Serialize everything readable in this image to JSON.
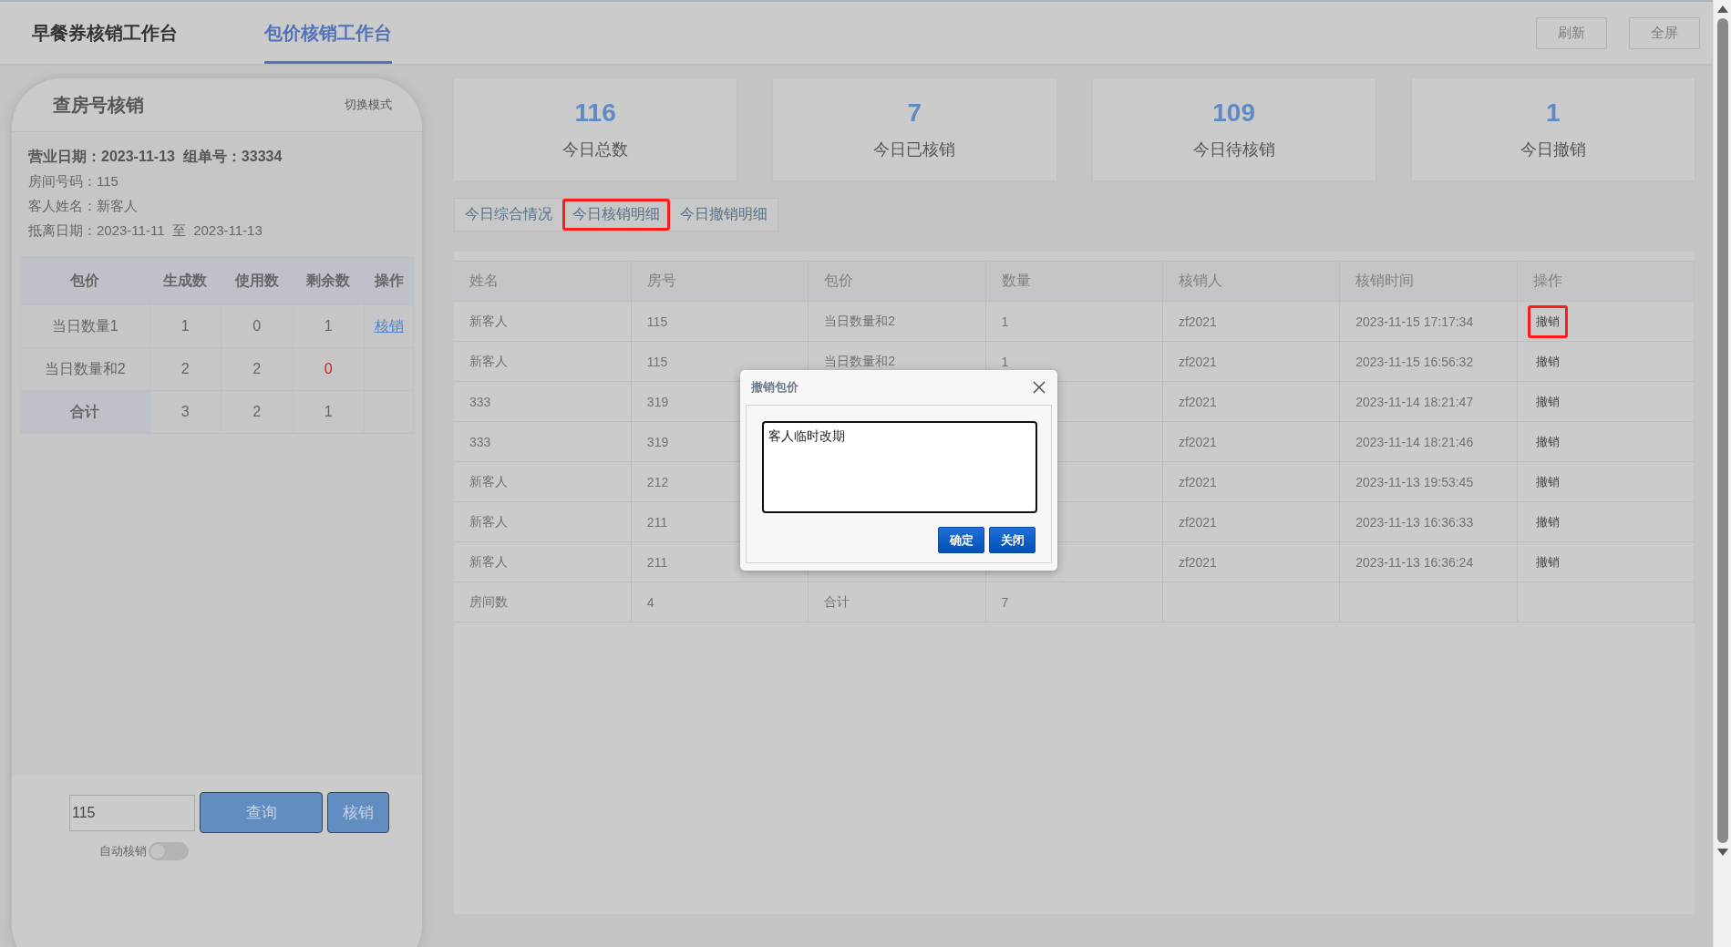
{
  "header": {
    "tabs": [
      {
        "label": "早餐券核销工作台",
        "selected": false
      },
      {
        "label": "包价核销工作台",
        "selected": true
      }
    ],
    "buttons": [
      {
        "label": "刷新",
        "disabled": true
      },
      {
        "label": "全屏",
        "disabled": true
      }
    ]
  },
  "room_panel": {
    "title": "查房号核销",
    "mode_link": "切换模式",
    "info": [
      {
        "label": "营业日期：",
        "value": "2023-11-13",
        "bold": true,
        "extra_label": "组单号：",
        "extra_value": "33334"
      },
      {
        "label": "房间号码：",
        "value": "115",
        "bold": false
      },
      {
        "label": "客人姓名：",
        "value": "新客人",
        "bold": false
      },
      {
        "label": "抵离日期：",
        "value": "2023-11-11  至  2023-11-13",
        "bold": false
      }
    ],
    "table": {
      "columns": [
        "包价",
        "生成数",
        "使用数",
        "剩余数",
        "操作"
      ],
      "rows": [
        {
          "kind": "item",
          "cells": [
            "当日数量1",
            "1",
            "0",
            "1"
          ],
          "alert": false,
          "action": "核销"
        },
        {
          "kind": "item",
          "cells": [
            "当日数量和2",
            "2",
            "2",
            "0"
          ],
          "alert": true
        },
        {
          "kind": "total",
          "cells": [
            "合计",
            "3",
            "2",
            "1"
          ],
          "alert": false
        }
      ]
    },
    "room_input": {
      "value": "115"
    },
    "query_button": "查询",
    "verify_button": "核销",
    "auto_verify": {
      "label": "自动核销",
      "on": false
    }
  },
  "stats": [
    {
      "value": "116",
      "label": "今日总数"
    },
    {
      "value": "7",
      "label": "今日已核销"
    },
    {
      "value": "109",
      "label": "今日待核销"
    },
    {
      "value": "1",
      "label": "今日撤销"
    }
  ],
  "sub_tabs": [
    {
      "label": "今日综合情况",
      "selected": false
    },
    {
      "label": "今日核销明细",
      "selected": true
    },
    {
      "label": "今日撤销明细",
      "selected": false
    }
  ],
  "detail_table": {
    "columns": [
      "姓名",
      "房号",
      "包价",
      "数量",
      "核销人",
      "核销时间",
      "操作"
    ],
    "rows": [
      {
        "cells": [
          "新客人",
          "115",
          "当日数量和2",
          "1",
          "zf2021",
          "2023-11-15 17:17:34"
        ],
        "action": "撤销",
        "highlighted": true
      },
      {
        "cells": [
          "新客人",
          "115",
          "当日数量和2",
          "1",
          "zf2021",
          "2023-11-15 16:56:32"
        ],
        "action": "撤销",
        "highlighted": false
      },
      {
        "cells": [
          "333",
          "319",
          "",
          "",
          "zf2021",
          "2023-11-14 18:21:47"
        ],
        "action": "撤销",
        "highlighted": false
      },
      {
        "cells": [
          "333",
          "319",
          "",
          "",
          "zf2021",
          "2023-11-14 18:21:46"
        ],
        "action": "撤销",
        "highlighted": false
      },
      {
        "cells": [
          "新客人",
          "212",
          "",
          "",
          "zf2021",
          "2023-11-13 19:53:45"
        ],
        "action": "撤销",
        "highlighted": false
      },
      {
        "cells": [
          "新客人",
          "211",
          "",
          "",
          "zf2021",
          "2023-11-13 16:36:33"
        ],
        "action": "撤销",
        "highlighted": false
      },
      {
        "cells": [
          "新客人",
          "211",
          "",
          "",
          "zf2021",
          "2023-11-13 16:36:24"
        ],
        "action": "撤销",
        "highlighted": false
      }
    ],
    "footer": [
      {
        "label": "房间数",
        "value": "4"
      },
      {
        "label": "合计",
        "value": "7"
      }
    ]
  },
  "dialog": {
    "title": "撤销包价",
    "reason": "客人临时改期",
    "buttons": [
      "确定",
      "关闭"
    ]
  }
}
